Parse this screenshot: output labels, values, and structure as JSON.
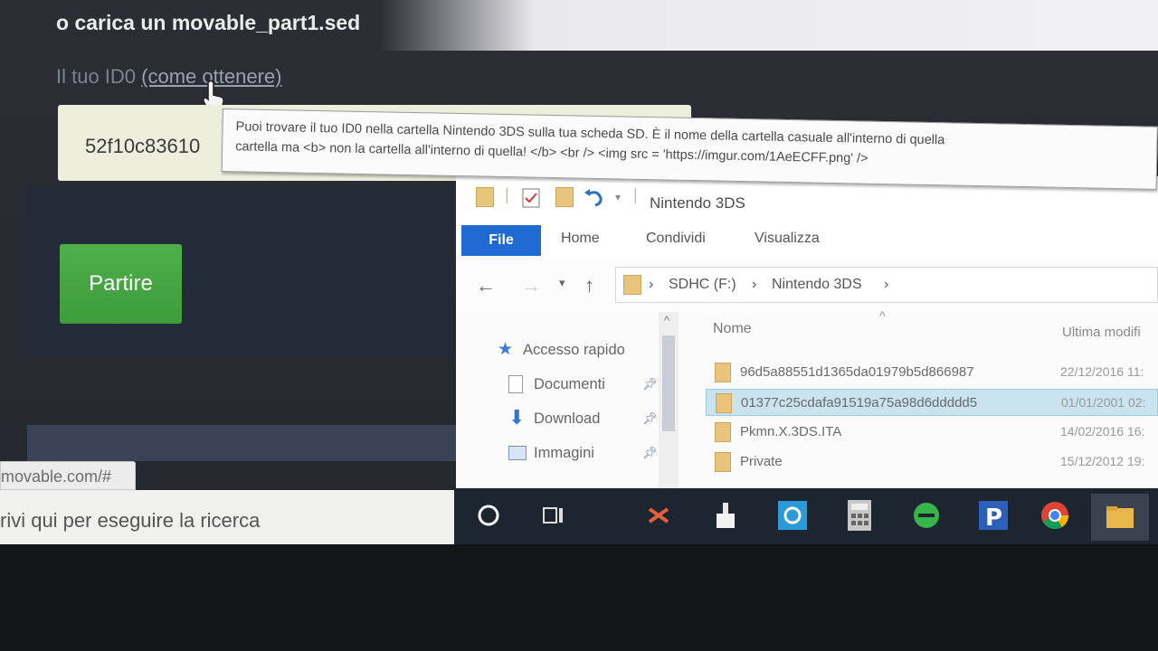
{
  "page": {
    "heading": "o carica un movable_part1.sed",
    "id_label": "Il tuo ID0",
    "id_label_link": "(come ottenere)",
    "id_value": "52f10c83610",
    "tooltip_line1": "Puoi trovare il tuo ID0 nella cartella Nintendo 3DS sulla tua scheda SD.  È il nome della cartella casuale all'interno di quella",
    "tooltip_line2": "cartella ma <b> non la cartella all'interno di quella! </b> <br /> <img src = 'https://imgur.com/1AeECFF.png' />",
    "go_button": "Partire",
    "status_url": "movable.com/#"
  },
  "explorer": {
    "title": "Nintendo 3DS",
    "ribbon": {
      "file": "File",
      "tabs": [
        "Home",
        "Condividi",
        "Visualizza"
      ]
    },
    "breadcrumb": [
      "SDHC (F:)",
      "Nintendo 3DS"
    ],
    "nav": [
      {
        "label": "Accesso rapido",
        "icon": "star-icon"
      },
      {
        "label": "Documenti",
        "icon": "document-icon"
      },
      {
        "label": "Download",
        "icon": "download-icon"
      },
      {
        "label": "Immagini",
        "icon": "pictures-icon"
      }
    ],
    "columns": {
      "name": "Nome",
      "date": "Ultima modifi"
    },
    "files": [
      {
        "name": "96d5a88551d1365da01979b5d866987",
        "date": "22/12/2016 11:"
      },
      {
        "name": "01377c25cdafa91519a75a98d6ddddd5",
        "date": "01/01/2001 02:"
      },
      {
        "name": "Pkmn.X.3DS.ITA",
        "date": "14/02/2016 16:"
      },
      {
        "name": "Private",
        "date": "15/12/2012 19:"
      }
    ]
  },
  "taskbar": {
    "search_placeholder": "rivi qui per eseguire la ricerca",
    "apps": [
      "cortana-icon",
      "task-view-icon",
      "unknown-app-icon",
      "paint-brush-app-icon",
      "blue-app-icon",
      "calculator-icon",
      "green-app-icon",
      "pandora-icon",
      "chrome-icon",
      "file-explorer-icon"
    ]
  }
}
